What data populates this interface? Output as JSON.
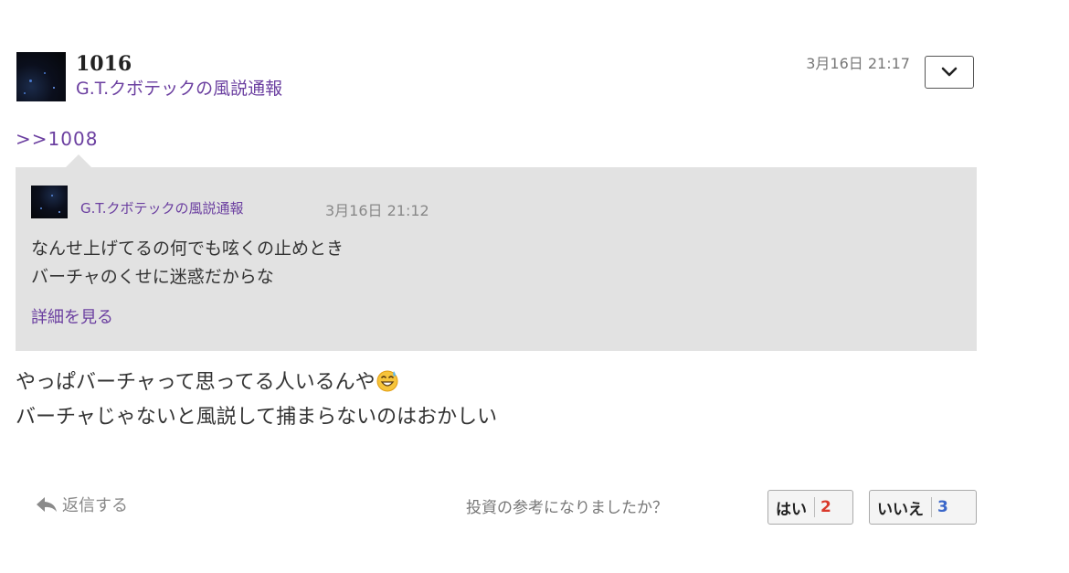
{
  "post": {
    "number": "1016",
    "author": "G.T.クボテックの風説通報",
    "timestamp": "3月16日 21:17",
    "menu_icon": "chevron-down-icon"
  },
  "reply_to": {
    "anchor": ">>1008",
    "author": "G.T.クボテックの風説通報",
    "timestamp": "3月16日 21:12",
    "lines": [
      "なんせ上げてるの何でも呟くの止めとき",
      "バーチャのくせに迷惑だからな"
    ],
    "more_link": "詳細を見る"
  },
  "body": {
    "line1": "やっぱバーチャって思ってる人いるんや",
    "line1_emoji": "grinning-sweat-emoji",
    "line2": "バーチャじゃないと風説して捕まらないのはおかしい"
  },
  "footer": {
    "reply_label": "返信する",
    "reply_icon": "reply-arrow-icon",
    "helpful_question": "投資の参考になりましたか？",
    "yes_label": "はい",
    "yes_count": "2",
    "no_label": "いいえ",
    "no_count": "3"
  },
  "colors": {
    "link": "#6b3fa0",
    "quote_bg": "#e2e2e2",
    "yes_count": "#d9392b",
    "no_count": "#3a66c9"
  }
}
